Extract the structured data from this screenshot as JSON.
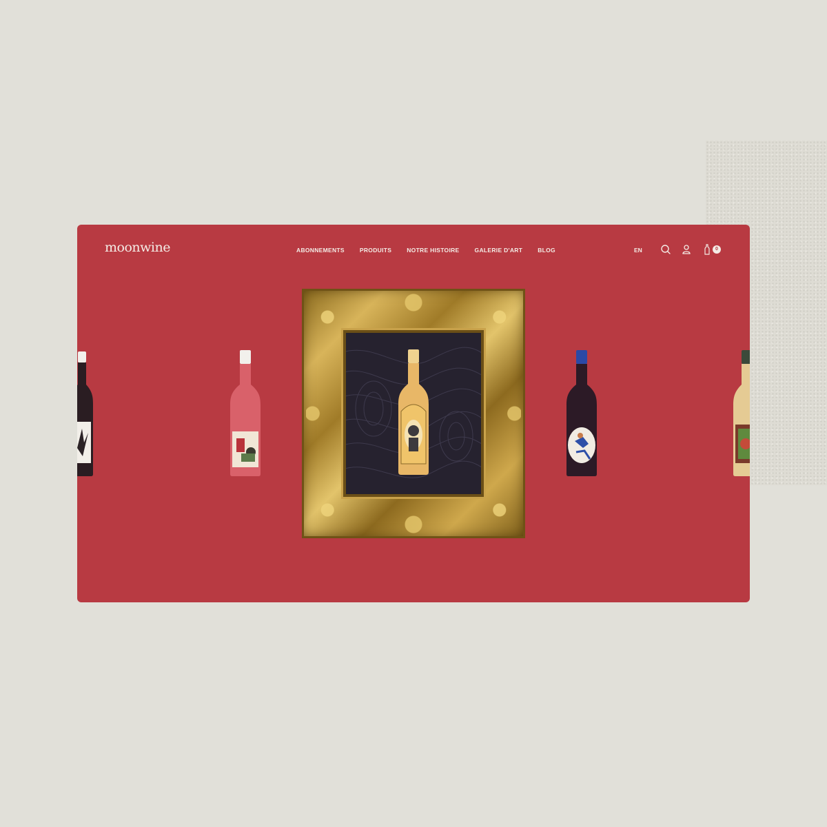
{
  "header": {
    "logo": "moonwine",
    "nav": [
      "ABONNEMENTS",
      "PRODUITS",
      "NOTRE HISTOIRE",
      "GALERIE D'ART",
      "BLOG"
    ],
    "lang": "EN",
    "cart_count": "0"
  },
  "icons": {
    "search": "search-icon",
    "account": "user-icon",
    "cart": "bottle-cart-icon"
  },
  "carousel": {
    "bottles": [
      {
        "name": "red-wine-left-edge",
        "glass": "#2a1d22",
        "capsule": "#f2f0ec"
      },
      {
        "name": "rose-wine",
        "glass": "#d9616a",
        "capsule": "#f2f0ec"
      },
      {
        "name": "orange-wine-featured",
        "glass": "#e8b767",
        "capsule": "#efd28f"
      },
      {
        "name": "red-wine-blue-capsule",
        "glass": "#2c1a26",
        "capsule": "#2b49a6"
      },
      {
        "name": "white-wine-right-edge",
        "glass": "#e5cb94",
        "capsule": "#3b4a3a"
      }
    ]
  },
  "colors": {
    "background": "#e1e0d9",
    "brand_red": "#b83a42",
    "text_light": "#f4ece6",
    "frame_gold": "#c9a24b"
  }
}
